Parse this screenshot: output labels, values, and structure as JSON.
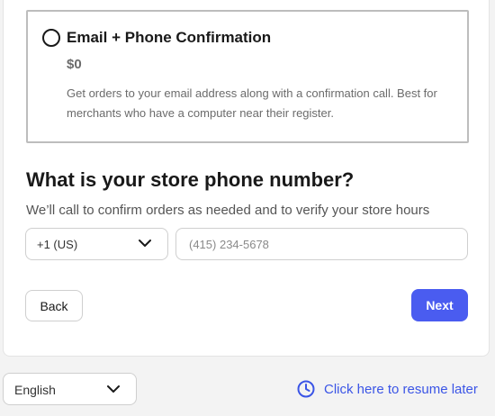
{
  "option": {
    "title": "Email + Phone Confirmation",
    "price": "$0",
    "description": "Get orders to your email address along with a confirmation call. Best for merchants who have a computer near their register."
  },
  "phone_section": {
    "heading": "What is your store phone number?",
    "subtext": "We’ll call to confirm orders as needed and to verify your store hours",
    "country_code": "+1 (US)",
    "phone_placeholder": "(415) 234-5678"
  },
  "actions": {
    "back_label": "Back",
    "next_label": "Next"
  },
  "footer": {
    "language": "English",
    "resume_label": "Click here to resume later"
  },
  "colors": {
    "accent": "#4a5cf0",
    "link": "#3b55e6"
  },
  "icons": {
    "radio": "radio-unselected-icon",
    "dropdown": "chevron-down-icon",
    "resume": "clock-icon"
  }
}
